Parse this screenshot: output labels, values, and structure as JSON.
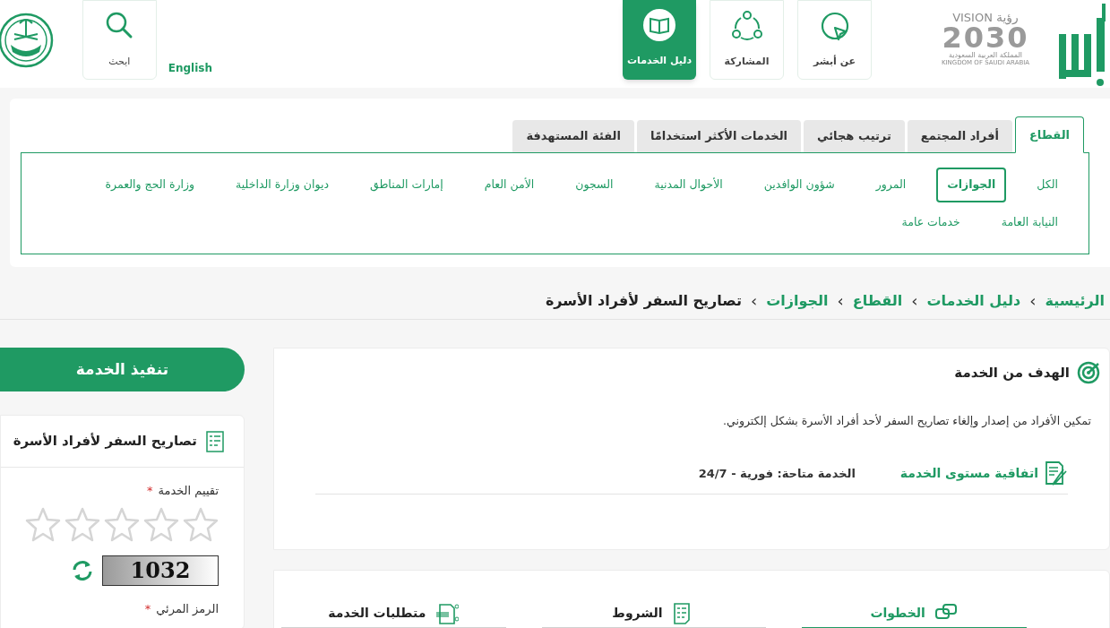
{
  "vision_logo": {
    "word_en": "VISION",
    "word_ar": "رؤية",
    "year": "2030",
    "country_ar": "المملكة العربية السعودية",
    "country_en": "KINGDOM OF SAUDI ARABIA"
  },
  "nav": [
    {
      "label": "عن أبشر",
      "kind": "about",
      "selected": false
    },
    {
      "label": "المشاركة",
      "kind": "share",
      "selected": false
    },
    {
      "label": "دليل الخدمات",
      "kind": "guide",
      "selected": true
    }
  ],
  "language_link": "English",
  "search": {
    "label": "ابحث"
  },
  "sector_tabs": [
    {
      "label": "القطاع",
      "selected": true
    },
    {
      "label": "أفراد المجتمع",
      "selected": false
    },
    {
      "label": "ترتيب هجائي",
      "selected": false
    },
    {
      "label": "الخدمات الأكثر استخدامًا",
      "selected": false
    },
    {
      "label": "الفئة المستهدفة",
      "selected": false
    }
  ],
  "sector_item_rows": [
    [
      {
        "label": "الكل",
        "selected": false
      },
      {
        "label": "الجوازات",
        "selected": true
      },
      {
        "label": "المرور",
        "selected": false
      },
      {
        "label": "شؤون الوافدين",
        "selected": false
      },
      {
        "label": "الأحوال المدنية",
        "selected": false
      },
      {
        "label": "السجون",
        "selected": false
      },
      {
        "label": "الأمن العام",
        "selected": false
      },
      {
        "label": "إمارات المناطق",
        "selected": false
      },
      {
        "label": "ديوان وزارة الداخلية",
        "selected": false
      },
      {
        "label": "وزارة الحج والعمرة",
        "selected": false
      }
    ],
    [
      {
        "label": "النيابة العامة",
        "selected": false
      },
      {
        "label": "خدمات عامة",
        "selected": false
      }
    ]
  ],
  "breadcrumb": [
    {
      "label": "الرئيسية",
      "current": false
    },
    {
      "label": "دليل الخدمات",
      "current": false
    },
    {
      "label": "القطاع",
      "current": false
    },
    {
      "label": "الجوازات",
      "current": false
    },
    {
      "label": "تصاريح السفر لأفراد الأسرة",
      "current": true
    }
  ],
  "breadcrumb_separator": "›",
  "goal": {
    "title": "الهدف من الخدمة",
    "description": "تمكين الأفراد من إصدار وإلغاء تصاريح السفر لأحد أفراد الأسرة بشكل إلكتروني.",
    "sla_link": "اتفاقية مستوى الخدمة",
    "availability": "الخدمة متاحة: فورية - 24/7"
  },
  "detail_tabs": [
    {
      "label": "الخطوات",
      "kind": "steps",
      "selected": true
    },
    {
      "label": "الشروط",
      "kind": "terms",
      "selected": false
    },
    {
      "label": "متطلبات الخدمة",
      "kind": "requirements",
      "selected": false
    }
  ],
  "execute_button": "تنفيذ الخدمة",
  "service_card": {
    "title": "تصاريح السفر لأفراد الأسرة",
    "rating": {
      "label": "تقييم الخدمة",
      "required_mark": "*",
      "stars": 0
    },
    "captcha": {
      "code": "1032"
    },
    "captcha_field": {
      "label": "الرمز المرئي",
      "required_mark": "*"
    }
  }
}
